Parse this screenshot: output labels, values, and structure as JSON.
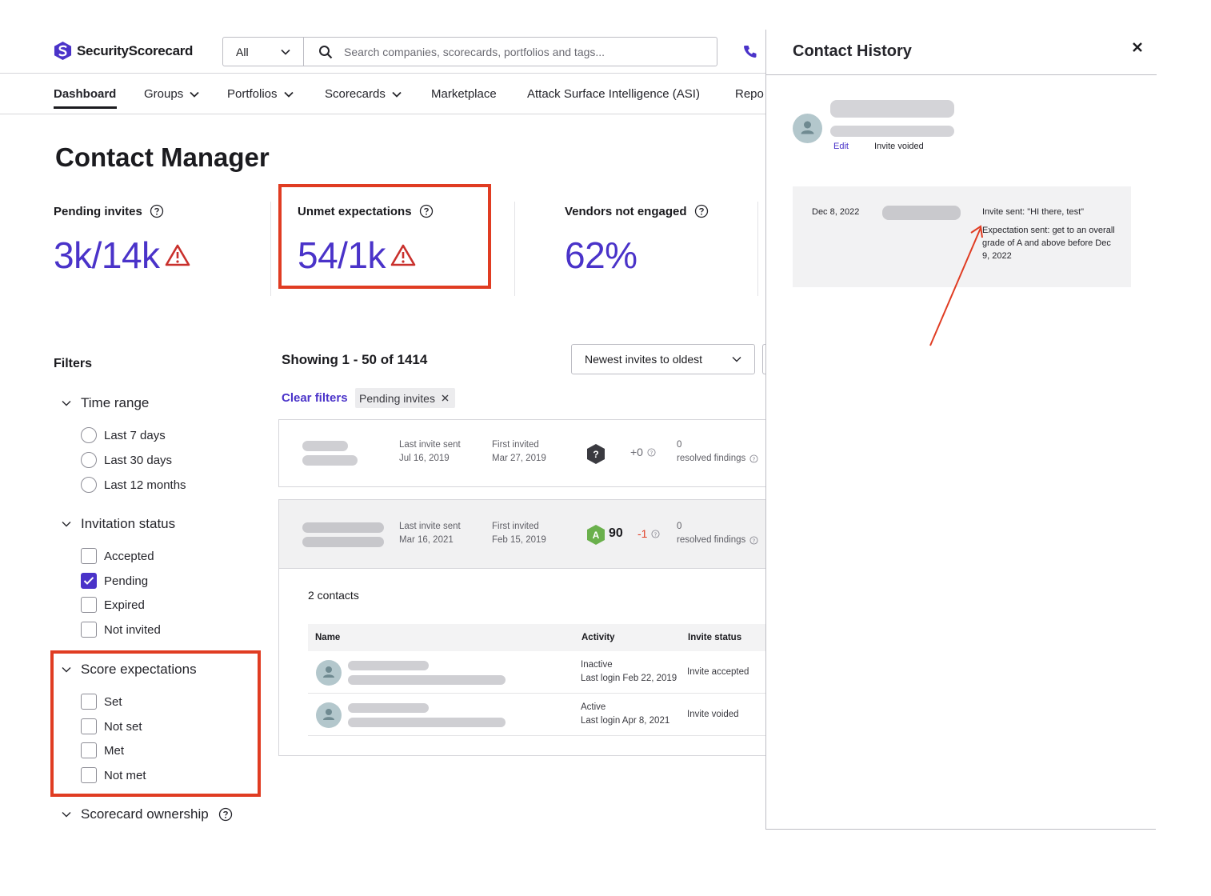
{
  "header": {
    "brand": "SecurityScorecard",
    "search_scope": "All",
    "search_placeholder": "Search companies, scorecards, portfolios and tags..."
  },
  "nav": {
    "items": [
      {
        "label": "Dashboard",
        "active": true,
        "dropdown": false
      },
      {
        "label": "Groups",
        "dropdown": true
      },
      {
        "label": "Portfolios",
        "dropdown": true
      },
      {
        "label": "Scorecards",
        "dropdown": true
      },
      {
        "label": "Marketplace",
        "dropdown": false
      },
      {
        "label": "Attack Surface Intelligence (ASI)",
        "dropdown": false
      },
      {
        "label": "Repo",
        "dropdown": false
      }
    ]
  },
  "page": {
    "title": "Contact Manager",
    "stats": [
      {
        "label": "Pending invites",
        "value": "3k/14k",
        "warning": true
      },
      {
        "label": "Unmet expectations",
        "value": "54/1k",
        "warning": true
      },
      {
        "label": "Vendors not engaged",
        "value": "62%",
        "warning": false
      }
    ]
  },
  "filters": {
    "title": "Filters",
    "groups": [
      {
        "label": "Time range",
        "type": "radio",
        "options": [
          "Last 7 days",
          "Last 30 days",
          "Last 12 months"
        ]
      },
      {
        "label": "Invitation status",
        "type": "checkbox",
        "options": [
          "Accepted",
          "Pending",
          "Expired",
          "Not invited"
        ],
        "checked": [
          "Pending"
        ]
      },
      {
        "label": "Score expectations",
        "type": "checkbox",
        "options": [
          "Set",
          "Not set",
          "Met",
          "Not met"
        ]
      },
      {
        "label": "Scorecard ownership"
      }
    ]
  },
  "list": {
    "showing": "Showing 1 - 50 of 1414",
    "sort": "Newest invites to oldest",
    "clear_filters": "Clear filters",
    "active_chip": "Pending invites",
    "vendors": [
      {
        "last_invite_label": "Last invite sent",
        "last_invite": "Jul 16, 2019",
        "first_invited_label": "First invited",
        "first_invited": "Mar 27, 2019",
        "grade": "?",
        "score": "",
        "delta": "+0",
        "resolved_count": "0",
        "resolved_label": "resolved findings"
      },
      {
        "last_invite_label": "Last invite sent",
        "last_invite": "Mar 16, 2021",
        "first_invited_label": "First invited",
        "first_invited": "Feb 15, 2019",
        "grade": "A",
        "score": "90",
        "delta": "-1",
        "resolved_count": "0",
        "resolved_label": "resolved findings"
      }
    ],
    "contacts": {
      "count_label": "2 contacts",
      "columns": [
        "Name",
        "Activity",
        "Invite status"
      ],
      "rows": [
        {
          "activity": "Inactive",
          "last_login": "Last login Feb 22, 2019",
          "status": "Invite accepted"
        },
        {
          "activity": "Active",
          "last_login": "Last login Apr 8, 2021",
          "status": "Invite voided"
        }
      ]
    }
  },
  "panel": {
    "title": "Contact History",
    "edit_label": "Edit",
    "status": "Invite voided",
    "history": [
      {
        "date": "Dec 8, 2022",
        "invite_text": "Invite sent: \"HI there, test\"",
        "expectation_text": "Expectation sent: get to an overall grade of A and above before Dec 9, 2022"
      }
    ]
  },
  "colors": {
    "brand": "#4a33c9",
    "highlight": "#e03c22",
    "grade_a": "#6ab04c",
    "grade_unknown": "#3a3a40"
  }
}
